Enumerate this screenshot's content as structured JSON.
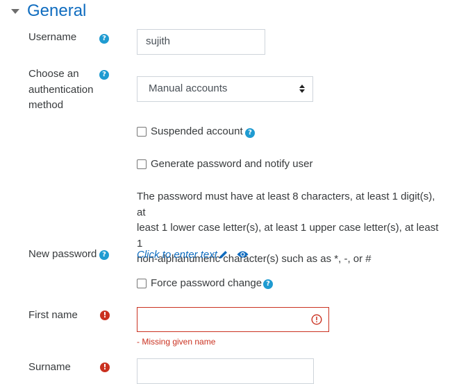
{
  "section": {
    "title": "General"
  },
  "username": {
    "label": "Username",
    "value": "sujith"
  },
  "auth": {
    "label_lines": [
      "Choose an",
      "authentication",
      "method"
    ],
    "selected": "Manual accounts"
  },
  "suspended": {
    "label": "Suspended account",
    "checked": false
  },
  "generate_password": {
    "label": "Generate password and notify user",
    "checked": false
  },
  "password_policy": {
    "lines": [
      "The password must have at least 8 characters, at least 1 digit(s), at",
      "least 1 lower case letter(s), at least 1 upper case letter(s), at least 1",
      "non-alphanumeric character(s) such as as *, -, or #"
    ]
  },
  "new_password": {
    "label": "New password",
    "link_text": "Click to enter text"
  },
  "force_change": {
    "label": "Force password change",
    "checked": false
  },
  "first_name": {
    "label": "First name",
    "value": "",
    "error": "- Missing given name"
  },
  "surname": {
    "label": "Surname",
    "value": ""
  },
  "icons": {
    "help": "?",
    "error": "!"
  },
  "colors": {
    "accent": "#0f6cbf",
    "help": "#1f9bd1",
    "error": "#ca3120"
  }
}
